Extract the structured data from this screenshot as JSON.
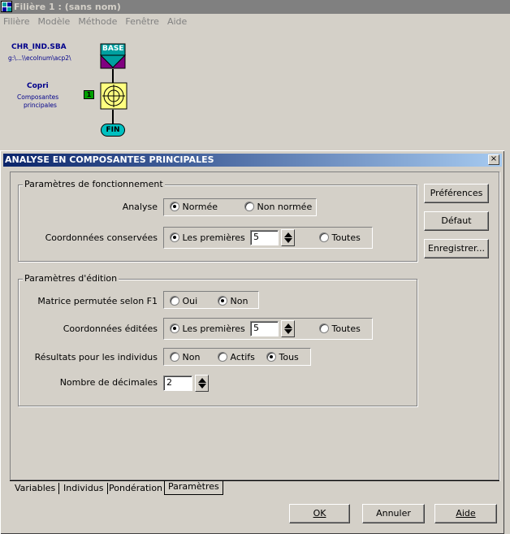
{
  "app": {
    "title": "Filière  1 : (sans nom)",
    "menu": [
      "Filière",
      "Modèle",
      "Méthode",
      "Fenêtre",
      "Aide"
    ]
  },
  "workflow": {
    "source_title": "CHR_IND.SBA",
    "source_path": "g:\\...\\\\ecolnum\\acp2\\",
    "base_label": "BASE",
    "method_title": "Copri",
    "method_sub1": "Composantes",
    "method_sub2": "principales",
    "method_badge": "1",
    "fin_label": "FIN",
    "colors": {
      "base_fill": "#00a0a0",
      "base_tail": "#800080",
      "method_fill": "#ffff80",
      "fin_fill": "#00c0c0",
      "badge": "#00a000"
    }
  },
  "dialog": {
    "title": "ANALYSE EN COMPOSANTES PRINCIPALES",
    "close_glyph": "×",
    "group1": {
      "title": "Paramètres de fonctionnement",
      "analyse_label": "Analyse",
      "analyse_options": [
        "Normée",
        "Non normée"
      ],
      "analyse_selected": "Normée",
      "coord_label": "Coordonnées conservées",
      "coord_first_label": "Les premières",
      "coord_value": "5",
      "coord_all_label": "Toutes",
      "coord_selected": "Les premières"
    },
    "group2": {
      "title": "Paramètres d'édition",
      "matrix_label": "Matrice permutée selon F1",
      "matrix_options": [
        "Oui",
        "Non"
      ],
      "matrix_selected": "Non",
      "coord_label": "Coordonnées éditées",
      "coord_first_label": "Les premières",
      "coord_value": "5",
      "coord_all_label": "Toutes",
      "coord_selected": "Les premières",
      "results_label": "Résultats pour les individus",
      "results_options": [
        "Non",
        "Actifs",
        "Tous"
      ],
      "results_selected": "Tous",
      "decimals_label": "Nombre de décimales",
      "decimals_value": "2"
    },
    "side_buttons": [
      "Préférences",
      "Défaut",
      "Enregistrer..."
    ],
    "tabs": [
      "Variables",
      "Individus",
      "Pondération",
      "Paramètres"
    ],
    "active_tab": "Paramètres",
    "footer": {
      "ok": "OK",
      "cancel": "Annuler",
      "help": "Aide"
    }
  }
}
